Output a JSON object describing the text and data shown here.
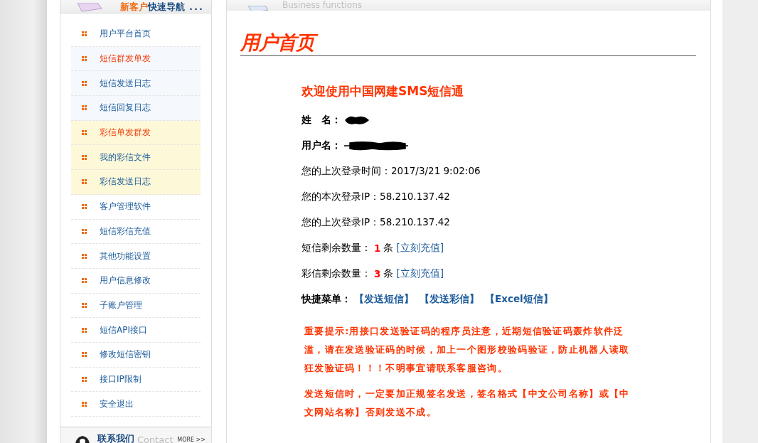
{
  "sidebar": {
    "header": {
      "title_part1": "新客户",
      "title_part2": "快速导航",
      "dots": "..."
    },
    "items": [
      {
        "label": "用户平台首页",
        "kind": "plain",
        "emphasized": false
      },
      {
        "label": "短信群发单发",
        "kind": "sms",
        "emphasized": true
      },
      {
        "label": "短信发送日志",
        "kind": "sms",
        "emphasized": false
      },
      {
        "label": "短信回复日志",
        "kind": "sms",
        "emphasized": false
      },
      {
        "label": "彩信单发群发",
        "kind": "mms",
        "emphasized": true
      },
      {
        "label": "我的彩信文件",
        "kind": "mms",
        "emphasized": false
      },
      {
        "label": "彩信发送日志",
        "kind": "mms",
        "emphasized": false
      },
      {
        "label": "客户管理软件",
        "kind": "plain",
        "emphasized": false
      },
      {
        "label": "短信彩信充值",
        "kind": "plain",
        "emphasized": false
      },
      {
        "label": "其他功能设置",
        "kind": "plain",
        "emphasized": false
      },
      {
        "label": "用户信息修改",
        "kind": "plain",
        "emphasized": false
      },
      {
        "label": "子账户管理",
        "kind": "plain",
        "emphasized": false
      },
      {
        "label": "短信API接口",
        "kind": "plain",
        "emphasized": false
      },
      {
        "label": "修改短信密钥",
        "kind": "plain",
        "emphasized": false
      },
      {
        "label": "接口IP限制",
        "kind": "plain",
        "emphasized": false
      },
      {
        "label": "安全退出",
        "kind": "plain",
        "emphasized": false
      }
    ],
    "contact": {
      "title": "联系我们",
      "subtitle": "Contact",
      "more": "MORE >>"
    }
  },
  "main": {
    "header_subtitle": "Business functions",
    "page_title": "用户首页",
    "welcome": "欢迎使用中国网建SMS短信通",
    "info": [
      {
        "kind": "redacted",
        "label": "姓　名："
      },
      {
        "kind": "redacted",
        "label": "用户名："
      },
      {
        "kind": "text",
        "label": "您的上次登录时间：",
        "value": "2017/3/21 9:02:06"
      },
      {
        "kind": "text",
        "label": "您的本次登录IP：",
        "value": "58.210.137.42"
      },
      {
        "kind": "text",
        "label": "您的上次登录IP：",
        "value": "58.210.137.42"
      },
      {
        "kind": "count",
        "label": "短信剩余数量：",
        "count": "1",
        "unit": "条",
        "link": "[立刻充值]"
      },
      {
        "kind": "count",
        "label": "彩信剩余数量：",
        "count": "3",
        "unit": "条",
        "link": "[立刻充值]"
      }
    ],
    "quick_menu": {
      "label": "快捷菜单：",
      "links": [
        "【发送短信】",
        "【发送彩信】",
        "【Excel短信】"
      ]
    },
    "notices": [
      "重要提示:用接口发送验证码的程序员注意，近期短信验证码轰炸软件泛滥，请在发送验证码的时候，加上一个图形校验码验证，防止机器人读取狂发验证码！！！不明事宜请联系客服咨询。",
      "发送短信时，一定要加正规签名发送，签名格式【中文公司名称】或【中文网站名称】否则发送不成。"
    ]
  }
}
